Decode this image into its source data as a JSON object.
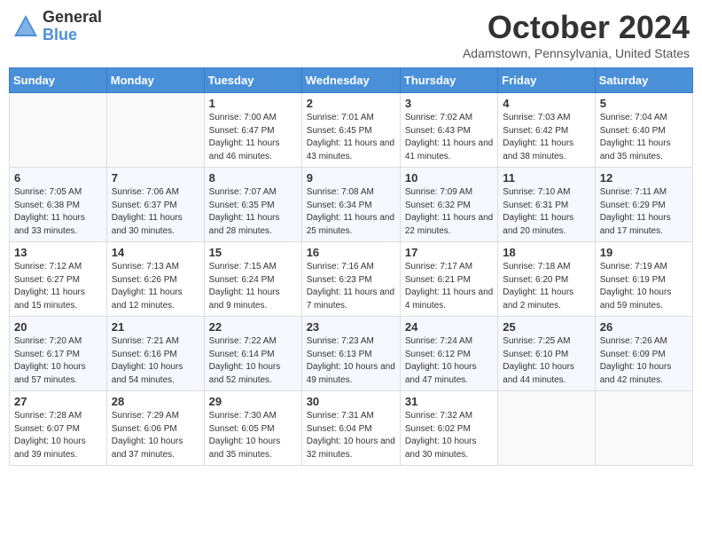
{
  "header": {
    "logo_general": "General",
    "logo_blue": "Blue",
    "month_title": "October 2024",
    "location": "Adamstown, Pennsylvania, United States"
  },
  "days_of_week": [
    "Sunday",
    "Monday",
    "Tuesday",
    "Wednesday",
    "Thursday",
    "Friday",
    "Saturday"
  ],
  "weeks": [
    [
      {
        "day": "",
        "sunrise": "",
        "sunset": "",
        "daylight": ""
      },
      {
        "day": "",
        "sunrise": "",
        "sunset": "",
        "daylight": ""
      },
      {
        "day": "1",
        "sunrise": "Sunrise: 7:00 AM",
        "sunset": "Sunset: 6:47 PM",
        "daylight": "Daylight: 11 hours and 46 minutes."
      },
      {
        "day": "2",
        "sunrise": "Sunrise: 7:01 AM",
        "sunset": "Sunset: 6:45 PM",
        "daylight": "Daylight: 11 hours and 43 minutes."
      },
      {
        "day": "3",
        "sunrise": "Sunrise: 7:02 AM",
        "sunset": "Sunset: 6:43 PM",
        "daylight": "Daylight: 11 hours and 41 minutes."
      },
      {
        "day": "4",
        "sunrise": "Sunrise: 7:03 AM",
        "sunset": "Sunset: 6:42 PM",
        "daylight": "Daylight: 11 hours and 38 minutes."
      },
      {
        "day": "5",
        "sunrise": "Sunrise: 7:04 AM",
        "sunset": "Sunset: 6:40 PM",
        "daylight": "Daylight: 11 hours and 35 minutes."
      }
    ],
    [
      {
        "day": "6",
        "sunrise": "Sunrise: 7:05 AM",
        "sunset": "Sunset: 6:38 PM",
        "daylight": "Daylight: 11 hours and 33 minutes."
      },
      {
        "day": "7",
        "sunrise": "Sunrise: 7:06 AM",
        "sunset": "Sunset: 6:37 PM",
        "daylight": "Daylight: 11 hours and 30 minutes."
      },
      {
        "day": "8",
        "sunrise": "Sunrise: 7:07 AM",
        "sunset": "Sunset: 6:35 PM",
        "daylight": "Daylight: 11 hours and 28 minutes."
      },
      {
        "day": "9",
        "sunrise": "Sunrise: 7:08 AM",
        "sunset": "Sunset: 6:34 PM",
        "daylight": "Daylight: 11 hours and 25 minutes."
      },
      {
        "day": "10",
        "sunrise": "Sunrise: 7:09 AM",
        "sunset": "Sunset: 6:32 PM",
        "daylight": "Daylight: 11 hours and 22 minutes."
      },
      {
        "day": "11",
        "sunrise": "Sunrise: 7:10 AM",
        "sunset": "Sunset: 6:31 PM",
        "daylight": "Daylight: 11 hours and 20 minutes."
      },
      {
        "day": "12",
        "sunrise": "Sunrise: 7:11 AM",
        "sunset": "Sunset: 6:29 PM",
        "daylight": "Daylight: 11 hours and 17 minutes."
      }
    ],
    [
      {
        "day": "13",
        "sunrise": "Sunrise: 7:12 AM",
        "sunset": "Sunset: 6:27 PM",
        "daylight": "Daylight: 11 hours and 15 minutes."
      },
      {
        "day": "14",
        "sunrise": "Sunrise: 7:13 AM",
        "sunset": "Sunset: 6:26 PM",
        "daylight": "Daylight: 11 hours and 12 minutes."
      },
      {
        "day": "15",
        "sunrise": "Sunrise: 7:15 AM",
        "sunset": "Sunset: 6:24 PM",
        "daylight": "Daylight: 11 hours and 9 minutes."
      },
      {
        "day": "16",
        "sunrise": "Sunrise: 7:16 AM",
        "sunset": "Sunset: 6:23 PM",
        "daylight": "Daylight: 11 hours and 7 minutes."
      },
      {
        "day": "17",
        "sunrise": "Sunrise: 7:17 AM",
        "sunset": "Sunset: 6:21 PM",
        "daylight": "Daylight: 11 hours and 4 minutes."
      },
      {
        "day": "18",
        "sunrise": "Sunrise: 7:18 AM",
        "sunset": "Sunset: 6:20 PM",
        "daylight": "Daylight: 11 hours and 2 minutes."
      },
      {
        "day": "19",
        "sunrise": "Sunrise: 7:19 AM",
        "sunset": "Sunset: 6:19 PM",
        "daylight": "Daylight: 10 hours and 59 minutes."
      }
    ],
    [
      {
        "day": "20",
        "sunrise": "Sunrise: 7:20 AM",
        "sunset": "Sunset: 6:17 PM",
        "daylight": "Daylight: 10 hours and 57 minutes."
      },
      {
        "day": "21",
        "sunrise": "Sunrise: 7:21 AM",
        "sunset": "Sunset: 6:16 PM",
        "daylight": "Daylight: 10 hours and 54 minutes."
      },
      {
        "day": "22",
        "sunrise": "Sunrise: 7:22 AM",
        "sunset": "Sunset: 6:14 PM",
        "daylight": "Daylight: 10 hours and 52 minutes."
      },
      {
        "day": "23",
        "sunrise": "Sunrise: 7:23 AM",
        "sunset": "Sunset: 6:13 PM",
        "daylight": "Daylight: 10 hours and 49 minutes."
      },
      {
        "day": "24",
        "sunrise": "Sunrise: 7:24 AM",
        "sunset": "Sunset: 6:12 PM",
        "daylight": "Daylight: 10 hours and 47 minutes."
      },
      {
        "day": "25",
        "sunrise": "Sunrise: 7:25 AM",
        "sunset": "Sunset: 6:10 PM",
        "daylight": "Daylight: 10 hours and 44 minutes."
      },
      {
        "day": "26",
        "sunrise": "Sunrise: 7:26 AM",
        "sunset": "Sunset: 6:09 PM",
        "daylight": "Daylight: 10 hours and 42 minutes."
      }
    ],
    [
      {
        "day": "27",
        "sunrise": "Sunrise: 7:28 AM",
        "sunset": "Sunset: 6:07 PM",
        "daylight": "Daylight: 10 hours and 39 minutes."
      },
      {
        "day": "28",
        "sunrise": "Sunrise: 7:29 AM",
        "sunset": "Sunset: 6:06 PM",
        "daylight": "Daylight: 10 hours and 37 minutes."
      },
      {
        "day": "29",
        "sunrise": "Sunrise: 7:30 AM",
        "sunset": "Sunset: 6:05 PM",
        "daylight": "Daylight: 10 hours and 35 minutes."
      },
      {
        "day": "30",
        "sunrise": "Sunrise: 7:31 AM",
        "sunset": "Sunset: 6:04 PM",
        "daylight": "Daylight: 10 hours and 32 minutes."
      },
      {
        "day": "31",
        "sunrise": "Sunrise: 7:32 AM",
        "sunset": "Sunset: 6:02 PM",
        "daylight": "Daylight: 10 hours and 30 minutes."
      },
      {
        "day": "",
        "sunrise": "",
        "sunset": "",
        "daylight": ""
      },
      {
        "day": "",
        "sunrise": "",
        "sunset": "",
        "daylight": ""
      }
    ]
  ]
}
